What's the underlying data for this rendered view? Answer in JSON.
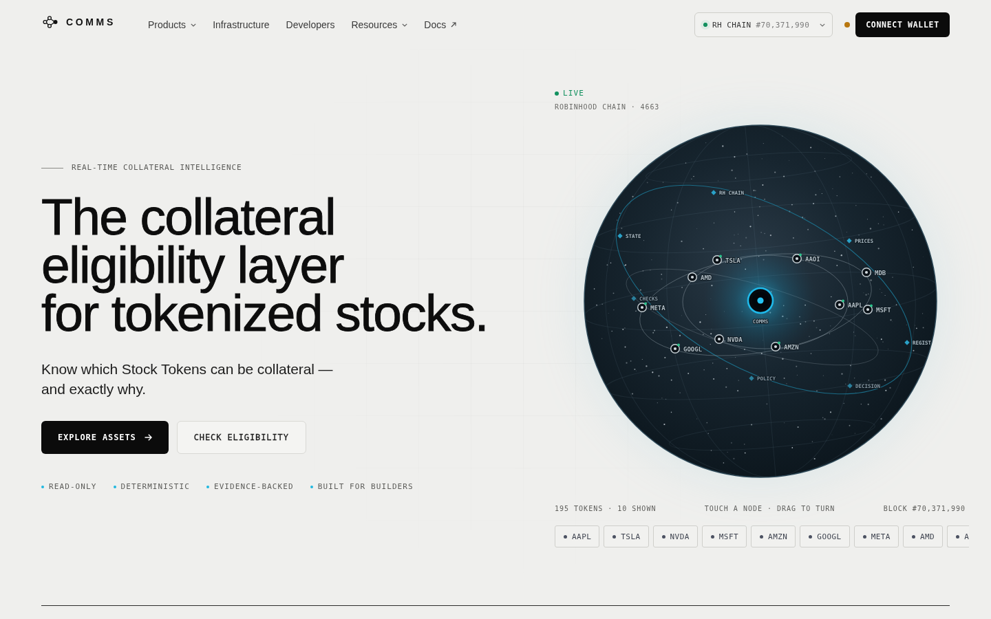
{
  "header": {
    "logo": "COMMS",
    "nav": [
      {
        "label": "Products",
        "kind": "menu"
      },
      {
        "label": "Infrastructure",
        "kind": "link"
      },
      {
        "label": "Developers",
        "kind": "link"
      },
      {
        "label": "Resources",
        "kind": "menu"
      },
      {
        "label": "Docs",
        "kind": "external"
      }
    ],
    "chain": {
      "name": "RH CHAIN",
      "block": "#70,371,990",
      "online": true
    },
    "wallet": {
      "label": "CONNECT WALLET",
      "connected": false
    }
  },
  "hero": {
    "eyebrow": "REAL-TIME COLLATERAL INTELLIGENCE",
    "headline": [
      "The collateral",
      "eligibility layer",
      "for tokenized stocks."
    ],
    "subtitle": "Know which Stock Tokens can be collateral — and exactly why.",
    "buttons": [
      {
        "label": "EXPLORE ASSETS",
        "kind": "primary"
      },
      {
        "label": "CHECK ELIGIBILITY",
        "kind": "secondary"
      }
    ],
    "features": [
      "READ-ONLY",
      "DETERMINISTIC",
      "EVIDENCE-BACKED",
      "BUILT FOR BUILDERS"
    ]
  },
  "network": {
    "status": {
      "label": "LIVE",
      "live": true
    },
    "caption": "ROBINHOOD CHAIN · 4663",
    "hub": "COMMS",
    "layers": [
      {
        "label": "RH CHAIN",
        "dimmed": false
      },
      {
        "label": "STATE",
        "dimmed": false
      },
      {
        "label": "PRICES",
        "dimmed": false
      },
      {
        "label": "CHECKS",
        "dimmed": true
      },
      {
        "label": "REGIST",
        "dimmed": false
      },
      {
        "label": "POLICY",
        "dimmed": true
      },
      {
        "label": "DECISION",
        "dimmed": true
      }
    ],
    "tokens": [
      {
        "label": "TSLA",
        "status_dot": true
      },
      {
        "label": "AAOI",
        "status_dot": true
      },
      {
        "label": "AMD",
        "status_dot": false
      },
      {
        "label": "MDB",
        "status_dot": false
      },
      {
        "label": "META",
        "status_dot": true
      },
      {
        "label": "AAPL",
        "status_dot": true
      },
      {
        "label": "MSFT",
        "status_dot": true
      },
      {
        "label": "NVDA",
        "status_dot": false
      },
      {
        "label": "GOOGL",
        "status_dot": true
      },
      {
        "label": "AMZN",
        "status_dot": true
      }
    ],
    "footer": {
      "count": "195 TOKENS · 10 SHOWN",
      "hint": "TOUCH A NODE · DRAG TO TURN",
      "block": "BLOCK #70,371,990"
    },
    "chips": [
      {
        "label": "AAPL",
        "selected": false,
        "clipped": false
      },
      {
        "label": "TSLA",
        "selected": false,
        "clipped": false
      },
      {
        "label": "NVDA",
        "selected": false,
        "clipped": false
      },
      {
        "label": "MSFT",
        "selected": false,
        "clipped": false
      },
      {
        "label": "AMZN",
        "selected": false,
        "clipped": false
      },
      {
        "label": "GOOGL",
        "selected": false,
        "clipped": false
      },
      {
        "label": "META",
        "selected": false,
        "clipped": false
      },
      {
        "label": "AMD",
        "selected": false,
        "clipped": false
      },
      {
        "label": "A",
        "selected": false,
        "clipped": true
      }
    ]
  }
}
